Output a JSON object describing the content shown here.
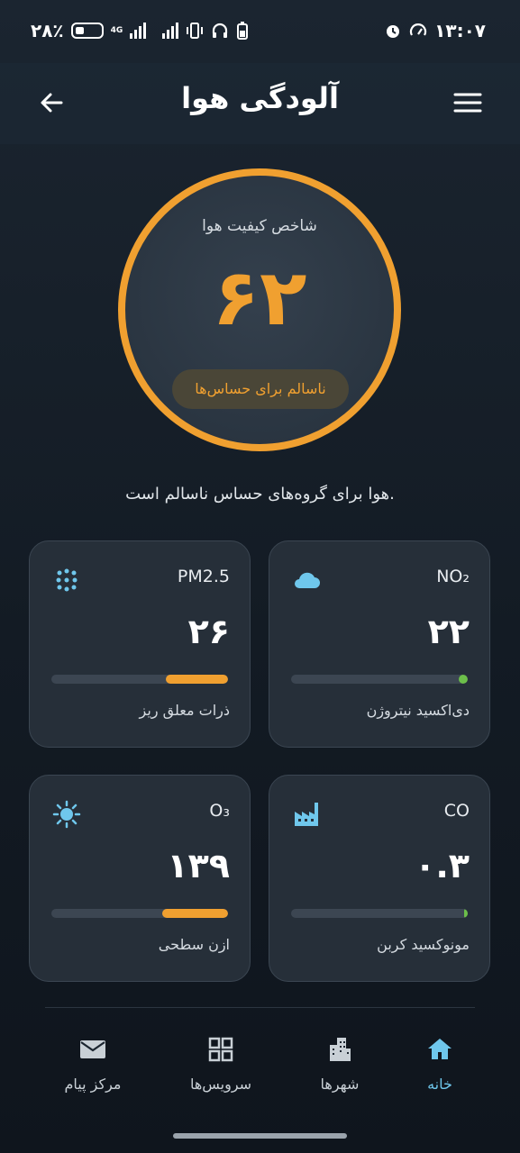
{
  "status": {
    "time": "۱۳:۰۷",
    "battery_percent": "۲۸٪",
    "network": "4G"
  },
  "header": {
    "title": "آلودگی هوا"
  },
  "aqi": {
    "label": "شاخص کیفیت هوا",
    "value": "۶۲",
    "category": "ناسالم برای حساس‌ها",
    "summary": "هوا برای گروه‌های حساس ناسالم است.",
    "color": "#f0a030"
  },
  "pollutants": [
    {
      "code": "NO₂",
      "value": "۲۲",
      "name": "دی‌اکسید نیتروژن",
      "level": 0.05,
      "color": "#6cbf4a",
      "icon": "cloud-icon"
    },
    {
      "code": "PM2.5",
      "value": "۲۶",
      "name": "ذرات معلق ریز",
      "level": 0.35,
      "color": "#f0a030",
      "icon": "particles-icon"
    },
    {
      "code": "CO",
      "value": "۰.۳",
      "name": "مونوکسید کربن",
      "level": 0.01,
      "color": "#6cbf4a",
      "icon": "factory-icon"
    },
    {
      "code": "O₃",
      "value": "۱۳۹",
      "name": "ازن سطحی",
      "level": 0.37,
      "color": "#f0a030",
      "icon": "sun-icon"
    }
  ],
  "nav": {
    "items": [
      {
        "label": "خانه",
        "icon": "home-icon",
        "active": true
      },
      {
        "label": "شهرها",
        "icon": "city-icon",
        "active": false
      },
      {
        "label": "سرویس‌ها",
        "icon": "grid-icon",
        "active": false
      },
      {
        "label": "مرکز پیام",
        "icon": "mail-icon",
        "active": false
      }
    ]
  },
  "accent_color": "#6fc7ec"
}
